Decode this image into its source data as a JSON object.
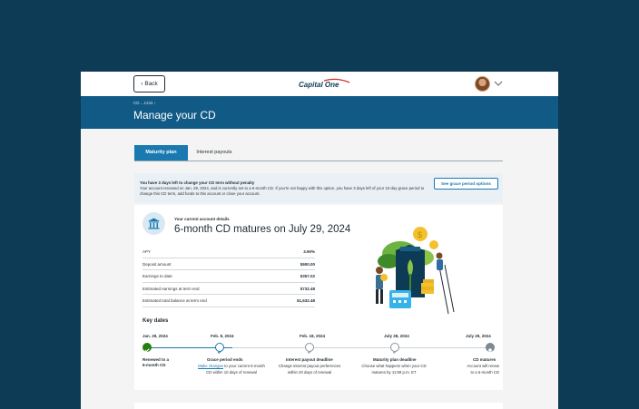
{
  "header": {
    "back_label": "Back",
    "logo_text": "Capital One"
  },
  "banner": {
    "crumb": "CD ...1234 ›",
    "title": "Manage your CD"
  },
  "tabs": [
    {
      "label": "Maturity plan",
      "active": true
    },
    {
      "label": "Interest payouts",
      "active": false
    }
  ],
  "alert": {
    "title": "You have 3 days left to change your CD term without penalty",
    "body": "Your account renewed on Jan. 29, 2024, and is currently set to a 6-month CD. If you're not happy with this option, you have 3 days left of your 10-day grace period to change this CD term, add funds to this account or close your account.",
    "button_label": "See grace period options"
  },
  "details": {
    "label": "Your current account details",
    "title": "6-month CD matures on July 29, 2024",
    "rows": [
      {
        "key": "APY",
        "value": "3.90%"
      },
      {
        "key": "Deposit amount",
        "value": "$900.00"
      },
      {
        "key": "Earnings to date",
        "value": "$357.02"
      },
      {
        "key": "Estimated earnings at term end",
        "value": "$732.48"
      },
      {
        "key": "Estimated total balance at term end",
        "value": "$1,632.48"
      }
    ]
  },
  "key_dates": {
    "label": "Key dates",
    "steps": [
      {
        "date": "Jan. 29, 2024",
        "title": "Renewed to a",
        "title2": "6-month CD",
        "status": "done"
      },
      {
        "date": "Feb. 8, 2024",
        "title": "Grace period ends",
        "link": "Make changes",
        "desc": "to your current 6-month",
        "desc2": "CD within 10 days of renewal",
        "status": "active"
      },
      {
        "date": "Feb. 18, 2024",
        "title": "Interest payout deadline",
        "desc": "Change interest payout preferences",
        "desc2": "within 20 days of renewal",
        "status": "future"
      },
      {
        "date": "July 28, 2024",
        "title": "Maturity plan deadline",
        "desc": "Choose what happens when your CD",
        "desc2": "matures by 11:59 p.m. ET",
        "status": "future"
      },
      {
        "date": "July 29, 2024",
        "title": "CD matures",
        "desc": "Account will renew",
        "desc2": "to a 6-month CD",
        "status": "final"
      }
    ]
  },
  "colors": {
    "page_bg": "#0d3a55",
    "banner": "#115a86",
    "accent": "#1a79b0",
    "success": "#25810e"
  }
}
